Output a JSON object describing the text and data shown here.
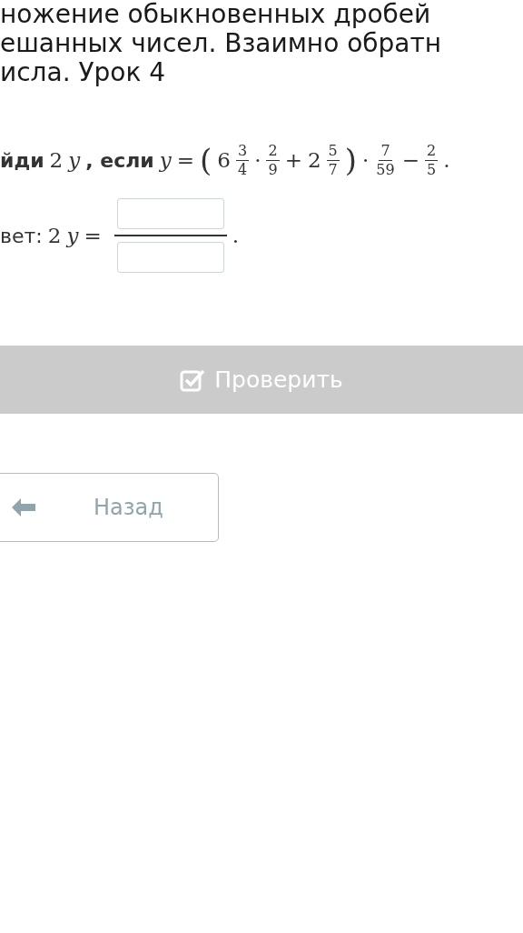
{
  "title_lines": [
    "ножение обыкновенных дробей",
    "ешанных чисел. Взаимно обратн",
    "исла. Урок 4"
  ],
  "task": [
    {
      "kind": "bold",
      "text": "йди"
    },
    {
      "kind": "num",
      "text": "2"
    },
    {
      "kind": "var",
      "text": "y"
    },
    {
      "kind": "bold",
      "text": ", если"
    },
    {
      "kind": "var",
      "text": "y"
    },
    {
      "kind": "op",
      "text": "="
    },
    {
      "kind": "paren",
      "text": "("
    },
    {
      "kind": "num",
      "text": "6"
    },
    {
      "kind": "frac",
      "num": "3",
      "den": "4"
    },
    {
      "kind": "op",
      "text": "·"
    },
    {
      "kind": "frac",
      "num": "2",
      "den": "9"
    },
    {
      "kind": "op",
      "text": "+"
    },
    {
      "kind": "num",
      "text": "2"
    },
    {
      "kind": "frac",
      "num": "5",
      "den": "7"
    },
    {
      "kind": "paren",
      "text": ")"
    },
    {
      "kind": "op",
      "text": "·"
    },
    {
      "kind": "frac",
      "num": "7",
      "den": "59"
    },
    {
      "kind": "op",
      "text": "−"
    },
    {
      "kind": "frac",
      "num": "2",
      "den": "5"
    },
    {
      "kind": "op",
      "text": "."
    }
  ],
  "answer": {
    "label": "вет:",
    "parts": [
      {
        "kind": "num",
        "text": "2"
      },
      {
        "kind": "var",
        "text": "y"
      },
      {
        "kind": "op",
        "text": "="
      }
    ],
    "end": "."
  },
  "check_button": {
    "label": "Проверить",
    "disabled": true
  },
  "back_button": {
    "label": "Назад"
  }
}
